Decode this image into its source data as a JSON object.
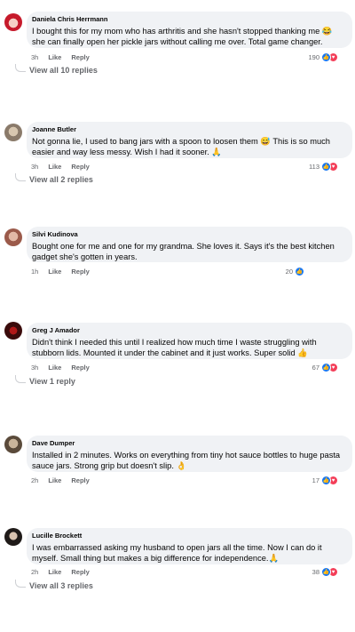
{
  "comments": [
    {
      "author": "Daniela Chris Herrmann",
      "text": "I bought this for my mom who has arthritis and she hasn't stopped thanking me 😂 she can finally open her pickle jars without calling me over. Total game changer.",
      "time": "3h",
      "like": "Like",
      "reply": "Reply",
      "reactions": "190",
      "reaction_types": [
        "like",
        "love"
      ],
      "view_replies": "View all 10 replies",
      "avatar_colors": [
        "#c61a2b",
        "#f5d0c5"
      ]
    },
    {
      "author": "Joanne Butler",
      "text": "Not gonna lie, I used to bang jars with a spoon to loosen them 😅 This is so much easier and way less messy. Wish I had it sooner. 🙏",
      "time": "3h",
      "like": "Like",
      "reply": "Reply",
      "reactions": "113",
      "reaction_types": [
        "like",
        "love"
      ],
      "view_replies": "View all 2 replies",
      "avatar_colors": [
        "#8a7a6a",
        "#d8c7b0"
      ]
    },
    {
      "author": "Silvi Kudinova",
      "text": "Bought one for me and one for my grandma. She loves it. Says it's the best kitchen gadget she's gotten in years.",
      "time": "1h",
      "like": "Like",
      "reply": "Reply",
      "reactions": "20",
      "reaction_types": [
        "like"
      ],
      "view_replies": "",
      "avatar_colors": [
        "#9b5a4a",
        "#e3b9a6"
      ]
    },
    {
      "author": "Greg J Amador",
      "text": "Didn't think I needed this until I realized how much time I waste struggling with stubborn lids. Mounted it under the cabinet and it just works. Super solid 👍",
      "time": "3h",
      "like": "Like",
      "reply": "Reply",
      "reactions": "67",
      "reaction_types": [
        "like",
        "love"
      ],
      "view_replies": "View 1 reply",
      "avatar_colors": [
        "#3a0b0b",
        "#b01818"
      ]
    },
    {
      "author": "Dave Dumper",
      "text": "Installed in 2 minutes. Works on everything from tiny hot sauce bottles to huge pasta sauce jars. Strong grip but doesn't slip. 👌",
      "time": "2h",
      "like": "Like",
      "reply": "Reply",
      "reactions": "17",
      "reaction_types": [
        "like",
        "love"
      ],
      "view_replies": "",
      "avatar_colors": [
        "#5a4a3a",
        "#c9b49a"
      ]
    },
    {
      "author": "Lucille Brockett",
      "text": "I was embarrassed asking my husband to open jars all the time. Now I can do it myself. Small thing but makes a big difference for independence.🙏",
      "time": "2h",
      "like": "Like",
      "reply": "Reply",
      "reactions": "38",
      "reaction_types": [
        "like",
        "love"
      ],
      "view_replies": "View all 3 replies",
      "avatar_colors": [
        "#1f1a18",
        "#d9c3b0"
      ]
    }
  ],
  "icons": {
    "like": "thumbs-up-icon",
    "love": "heart-icon"
  },
  "colors": {
    "bubble": "#f0f2f5",
    "meta": "#65676b",
    "like": "#1877f2",
    "love": "#f33e58"
  }
}
